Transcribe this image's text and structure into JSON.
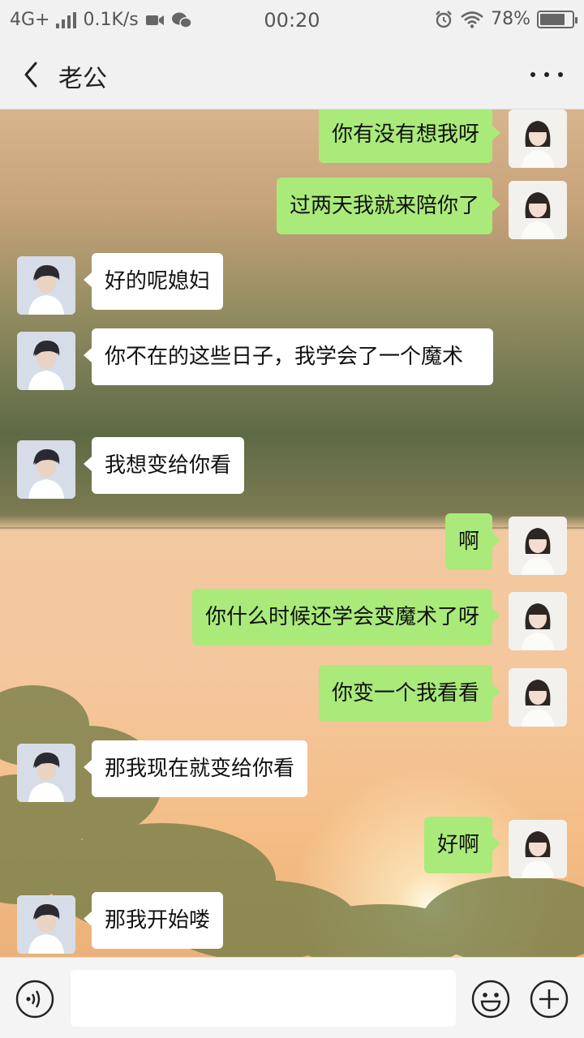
{
  "status_bar": {
    "network": "4G+",
    "speed": "0.1K/s",
    "time": "00:20",
    "battery": "78%",
    "battery_level": 0.78,
    "icons": [
      "signal-bars-icon",
      "video-icon",
      "wechat-icon",
      "alarm-icon",
      "wifi-icon",
      "battery-icon"
    ]
  },
  "header": {
    "back_icon": "chevron-left-icon",
    "title": "老公",
    "more_icon": "more-dots-icon"
  },
  "messages": [
    {
      "side": "sent",
      "text": "你有没有想我呀"
    },
    {
      "side": "sent",
      "text": "过两天我就来陪你了"
    },
    {
      "side": "recv",
      "text": "好的呢媳妇"
    },
    {
      "side": "recv",
      "text": "你不在的这些日子，我学会了一个魔术"
    },
    {
      "side": "recv",
      "text": "我想变给你看"
    },
    {
      "side": "sent",
      "text": "啊"
    },
    {
      "side": "sent",
      "text": "你什么时候还学会变魔术了呀"
    },
    {
      "side": "sent",
      "text": "你变一个我看看"
    },
    {
      "side": "recv",
      "text": "那我现在就变给你看"
    },
    {
      "side": "sent",
      "text": "好啊"
    },
    {
      "side": "recv",
      "text": "那我开始喽"
    }
  ],
  "input_bar": {
    "voice_icon": "voice-icon",
    "input_value": "",
    "emoji_icon": "emoji-icon",
    "plus_icon": "plus-icon"
  },
  "colors": {
    "sent_bubble": "#a9ea7a",
    "recv_bubble": "#ffffff",
    "bar_background": "#f1f1f1"
  }
}
